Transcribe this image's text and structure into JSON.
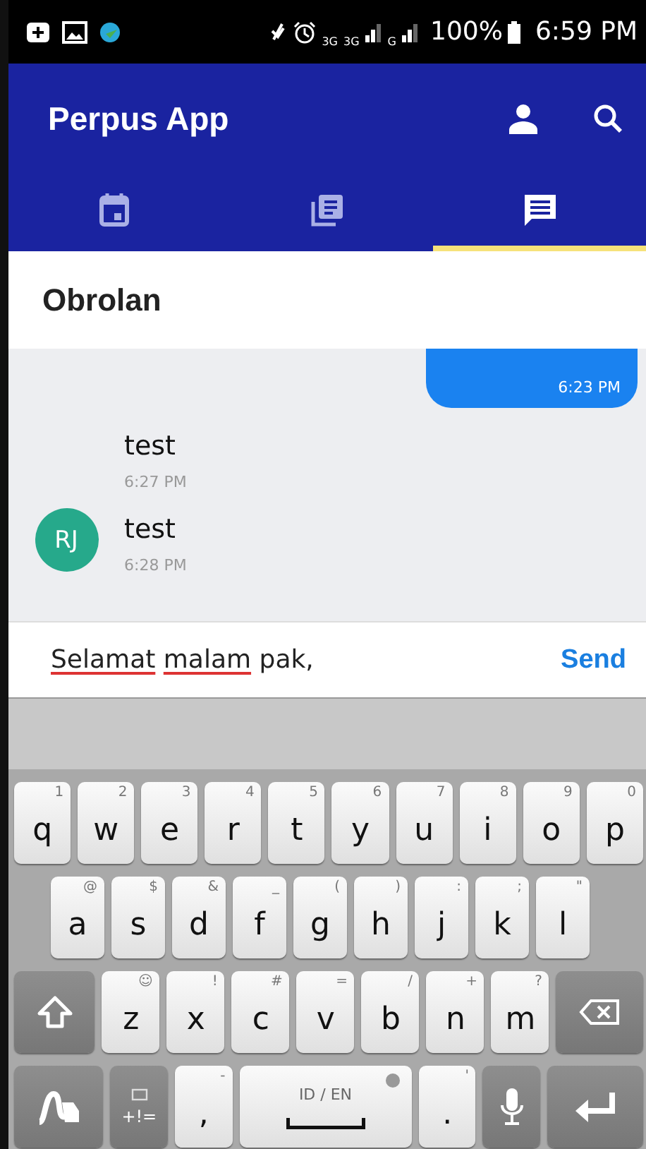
{
  "status_bar": {
    "network_labels": [
      "3G",
      "3G",
      "G"
    ],
    "battery": "100%",
    "time": "6:59 PM"
  },
  "app_bar": {
    "title": "Perpus App"
  },
  "tabs": [
    {
      "kind": "calendar",
      "selected": false
    },
    {
      "kind": "library",
      "selected": false
    },
    {
      "kind": "chat",
      "selected": true
    }
  ],
  "section_title": "Obrolan",
  "messages": [
    {
      "kind": "outgoing",
      "time": "6:23 PM"
    },
    {
      "kind": "incoming",
      "text": "test",
      "time": "6:27 PM"
    },
    {
      "kind": "incoming",
      "text": "test",
      "time": "6:28 PM",
      "avatar": "RJ"
    }
  ],
  "composer": {
    "value_words": [
      {
        "text": "Selamat",
        "misspelled": true
      },
      {
        "text": "malam",
        "misspelled": true
      },
      {
        "text": "pak,",
        "misspelled": false
      }
    ],
    "send": "Send"
  },
  "keyboard": {
    "key_rows": [
      {
        "keys": [
          {
            "kind": "letter",
            "label": "q",
            "hint": "1"
          },
          {
            "kind": "letter",
            "label": "w",
            "hint": "2"
          },
          {
            "kind": "letter",
            "label": "e",
            "hint": "3"
          },
          {
            "kind": "letter",
            "label": "r",
            "hint": "4"
          },
          {
            "kind": "letter",
            "label": "t",
            "hint": "5"
          },
          {
            "kind": "letter",
            "label": "y",
            "hint": "6"
          },
          {
            "kind": "letter",
            "label": "u",
            "hint": "7"
          },
          {
            "kind": "letter",
            "label": "i",
            "hint": "8"
          },
          {
            "kind": "letter",
            "label": "o",
            "hint": "9"
          },
          {
            "kind": "letter",
            "label": "p",
            "hint": "0"
          }
        ]
      },
      {
        "keys": [
          {
            "kind": "letter",
            "label": "a",
            "hint": "@"
          },
          {
            "kind": "letter",
            "label": "s",
            "hint": "$"
          },
          {
            "kind": "letter",
            "label": "d",
            "hint": "&"
          },
          {
            "kind": "letter",
            "label": "f",
            "hint": "_"
          },
          {
            "kind": "letter",
            "label": "g",
            "hint": "("
          },
          {
            "kind": "letter",
            "label": "h",
            "hint": ")"
          },
          {
            "kind": "letter",
            "label": "j",
            "hint": ":"
          },
          {
            "kind": "letter",
            "label": "k",
            "hint": ";"
          },
          {
            "kind": "letter",
            "label": "l",
            "hint": "\""
          }
        ]
      },
      {
        "keys": [
          {
            "kind": "shift"
          },
          {
            "kind": "letter",
            "label": "z",
            "hint": "☺"
          },
          {
            "kind": "letter",
            "label": "x",
            "hint": "!"
          },
          {
            "kind": "letter",
            "label": "c",
            "hint": "#"
          },
          {
            "kind": "letter",
            "label": "v",
            "hint": "="
          },
          {
            "kind": "letter",
            "label": "b",
            "hint": "/"
          },
          {
            "kind": "letter",
            "label": "n",
            "hint": "+"
          },
          {
            "kind": "letter",
            "label": "m",
            "hint": "?"
          },
          {
            "kind": "backspace"
          }
        ]
      },
      {
        "keys": [
          {
            "kind": "handwriting"
          },
          {
            "kind": "symbols",
            "label": "+!="
          },
          {
            "kind": "letter",
            "label": ",",
            "hint": "-"
          },
          {
            "kind": "space",
            "label": "ID / EN"
          },
          {
            "kind": "letter",
            "label": ".",
            "hint": "'"
          },
          {
            "kind": "mic"
          },
          {
            "kind": "enter"
          }
        ]
      }
    ]
  }
}
